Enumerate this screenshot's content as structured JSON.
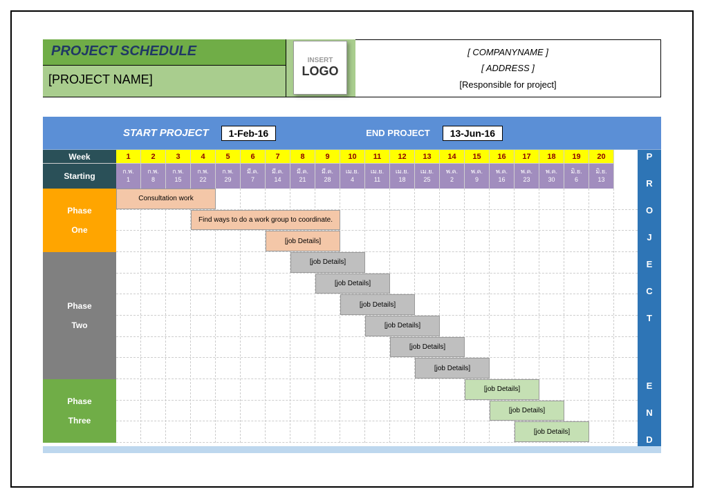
{
  "header": {
    "title": "PROJECT SCHEDULE",
    "project_name": "[PROJECT NAME]",
    "logo_insert": "INSERT",
    "logo_text": "LOGO",
    "company_name": "[ COMPANYNAME ]",
    "address": "[ ADDRESS ]",
    "responsible": "[Responsible for project]"
  },
  "dates": {
    "start_label": "START PROJECT",
    "start_value": "1-Feb-16",
    "end_label": "END PROJECT",
    "end_value": "13-Jun-16"
  },
  "labels": {
    "week": "Week",
    "starting": "Starting",
    "project_end": "P R O J E C T   E N D"
  },
  "weeks": [
    "1",
    "2",
    "3",
    "4",
    "5",
    "6",
    "7",
    "8",
    "9",
    "10",
    "11",
    "12",
    "13",
    "14",
    "15",
    "16",
    "17",
    "18",
    "19",
    "20"
  ],
  "start_dates": [
    {
      "m": "ก.พ.",
      "d": "1"
    },
    {
      "m": "ก.พ.",
      "d": "8"
    },
    {
      "m": "ก.พ.",
      "d": "15"
    },
    {
      "m": "ก.พ.",
      "d": "22"
    },
    {
      "m": "ก.พ.",
      "d": "29"
    },
    {
      "m": "มี.ค.",
      "d": "7"
    },
    {
      "m": "มี.ค.",
      "d": "14"
    },
    {
      "m": "มี.ค.",
      "d": "21"
    },
    {
      "m": "มี.ค.",
      "d": "28"
    },
    {
      "m": "เม.ย.",
      "d": "4"
    },
    {
      "m": "เม.ย.",
      "d": "11"
    },
    {
      "m": "เม.ย.",
      "d": "18"
    },
    {
      "m": "เม.ย.",
      "d": "25"
    },
    {
      "m": "พ.ค.",
      "d": "2"
    },
    {
      "m": "พ.ค.",
      "d": "9"
    },
    {
      "m": "พ.ค.",
      "d": "16"
    },
    {
      "m": "พ.ค.",
      "d": "23"
    },
    {
      "m": "พ.ค.",
      "d": "30"
    },
    {
      "m": "มิ.ย.",
      "d": "6"
    },
    {
      "m": "มิ.ย.",
      "d": "13"
    }
  ],
  "phases": {
    "one": {
      "line1": "Phase",
      "line2": "One"
    },
    "two": {
      "line1": "Phase",
      "line2": "Two"
    },
    "three": {
      "line1": "Phase",
      "line2": "Three"
    }
  },
  "tasks": [
    {
      "label": "Consultation work",
      "start": 0,
      "span": 4,
      "color": "c-orange",
      "row": 0
    },
    {
      "label": "Find ways to do a work group to coordinate.",
      "start": 3,
      "span": 6,
      "color": "c-orange",
      "row": 1
    },
    {
      "label": "[job Details]",
      "start": 6,
      "span": 3,
      "color": "c-orange",
      "row": 2
    },
    {
      "label": "[job Details]",
      "start": 7,
      "span": 3,
      "color": "c-gray",
      "row": 3
    },
    {
      "label": "[job Details]",
      "start": 8,
      "span": 3,
      "color": "c-gray",
      "row": 4
    },
    {
      "label": "[job Details]",
      "start": 9,
      "span": 3,
      "color": "c-gray",
      "row": 5
    },
    {
      "label": "[job Details]",
      "start": 10,
      "span": 3,
      "color": "c-gray",
      "row": 6
    },
    {
      "label": "[job Details]",
      "start": 11,
      "span": 3,
      "color": "c-gray",
      "row": 7
    },
    {
      "label": "[job Details]",
      "start": 12,
      "span": 3,
      "color": "c-gray",
      "row": 8
    },
    {
      "label": "[job Details]",
      "start": 14,
      "span": 3,
      "color": "c-green",
      "row": 9
    },
    {
      "label": "[job Details]",
      "start": 15,
      "span": 3,
      "color": "c-green",
      "row": 10
    },
    {
      "label": "[job Details]",
      "start": 16,
      "span": 3,
      "color": "c-green",
      "row": 11
    }
  ],
  "chart_data": {
    "type": "bar",
    "title": "PROJECT SCHEDULE",
    "xlabel": "Week",
    "ylabel": "",
    "categories": [
      "1",
      "2",
      "3",
      "4",
      "5",
      "6",
      "7",
      "8",
      "9",
      "10",
      "11",
      "12",
      "13",
      "14",
      "15",
      "16",
      "17",
      "18",
      "19",
      "20"
    ],
    "series": [
      {
        "name": "Phase One",
        "tasks": [
          {
            "name": "Consultation work",
            "start_week": 1,
            "end_week": 4
          },
          {
            "name": "Find ways to do a work group to coordinate.",
            "start_week": 4,
            "end_week": 9
          },
          {
            "name": "[job Details]",
            "start_week": 7,
            "end_week": 9
          }
        ]
      },
      {
        "name": "Phase Two",
        "tasks": [
          {
            "name": "[job Details]",
            "start_week": 8,
            "end_week": 10
          },
          {
            "name": "[job Details]",
            "start_week": 9,
            "end_week": 11
          },
          {
            "name": "[job Details]",
            "start_week": 10,
            "end_week": 12
          },
          {
            "name": "[job Details]",
            "start_week": 11,
            "end_week": 13
          },
          {
            "name": "[job Details]",
            "start_week": 12,
            "end_week": 14
          },
          {
            "name": "[job Details]",
            "start_week": 13,
            "end_week": 15
          }
        ]
      },
      {
        "name": "Phase Three",
        "tasks": [
          {
            "name": "[job Details]",
            "start_week": 15,
            "end_week": 17
          },
          {
            "name": "[job Details]",
            "start_week": 16,
            "end_week": 18
          },
          {
            "name": "[job Details]",
            "start_week": 17,
            "end_week": 19
          }
        ]
      }
    ],
    "start_date": "1-Feb-16",
    "end_date": "13-Jun-16"
  }
}
